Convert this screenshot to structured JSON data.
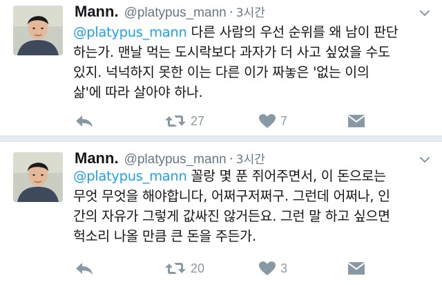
{
  "colors": {
    "link": "#1da1f2",
    "secondary_text": "#657786",
    "icon": "#8899a6",
    "separator": "#e6ecf0"
  },
  "tweets": [
    {
      "author_name": "Mann.",
      "handle": "@platypus_mann",
      "dot": "·",
      "time": "3시간",
      "mention": "@platypus_mann",
      "text_lines": [
        "다른 사람의 우선 순위를 왜 남이 판단",
        "하는가. 맨날 먹는 도시락보다 과자가 더 사고 싶었을 수도",
        "있지. 넉넉하지 못한 이는 다른 이가 짜놓은 '없는 이의",
        "삶'에 따라 살아야 하나."
      ],
      "icons": {
        "reply": "reply-icon",
        "retweet": "retweet-icon",
        "like": "heart-icon",
        "dm": "envelope-icon"
      },
      "retweet_count": "27",
      "like_count": "7"
    },
    {
      "author_name": "Mann.",
      "handle": "@platypus_mann",
      "dot": "·",
      "time": "3시간",
      "mention": "@platypus_mann",
      "text_lines": [
        "꼴랑 몇 푼 쥐어주면서, 이 돈으로는",
        "무엇 무엇을 해야합니다, 어쩌구저쩌구. 그런데 어쩌나, 인",
        "간의 자유가 그렇게 값싸진 않거든요. 그런 말 하고 싶으면",
        "헉소리 나올 만큼 큰 돈을 주든가."
      ],
      "icons": {
        "reply": "reply-icon",
        "retweet": "retweet-icon",
        "like": "heart-icon",
        "dm": "envelope-icon"
      },
      "retweet_count": "20",
      "like_count": "3"
    }
  ]
}
